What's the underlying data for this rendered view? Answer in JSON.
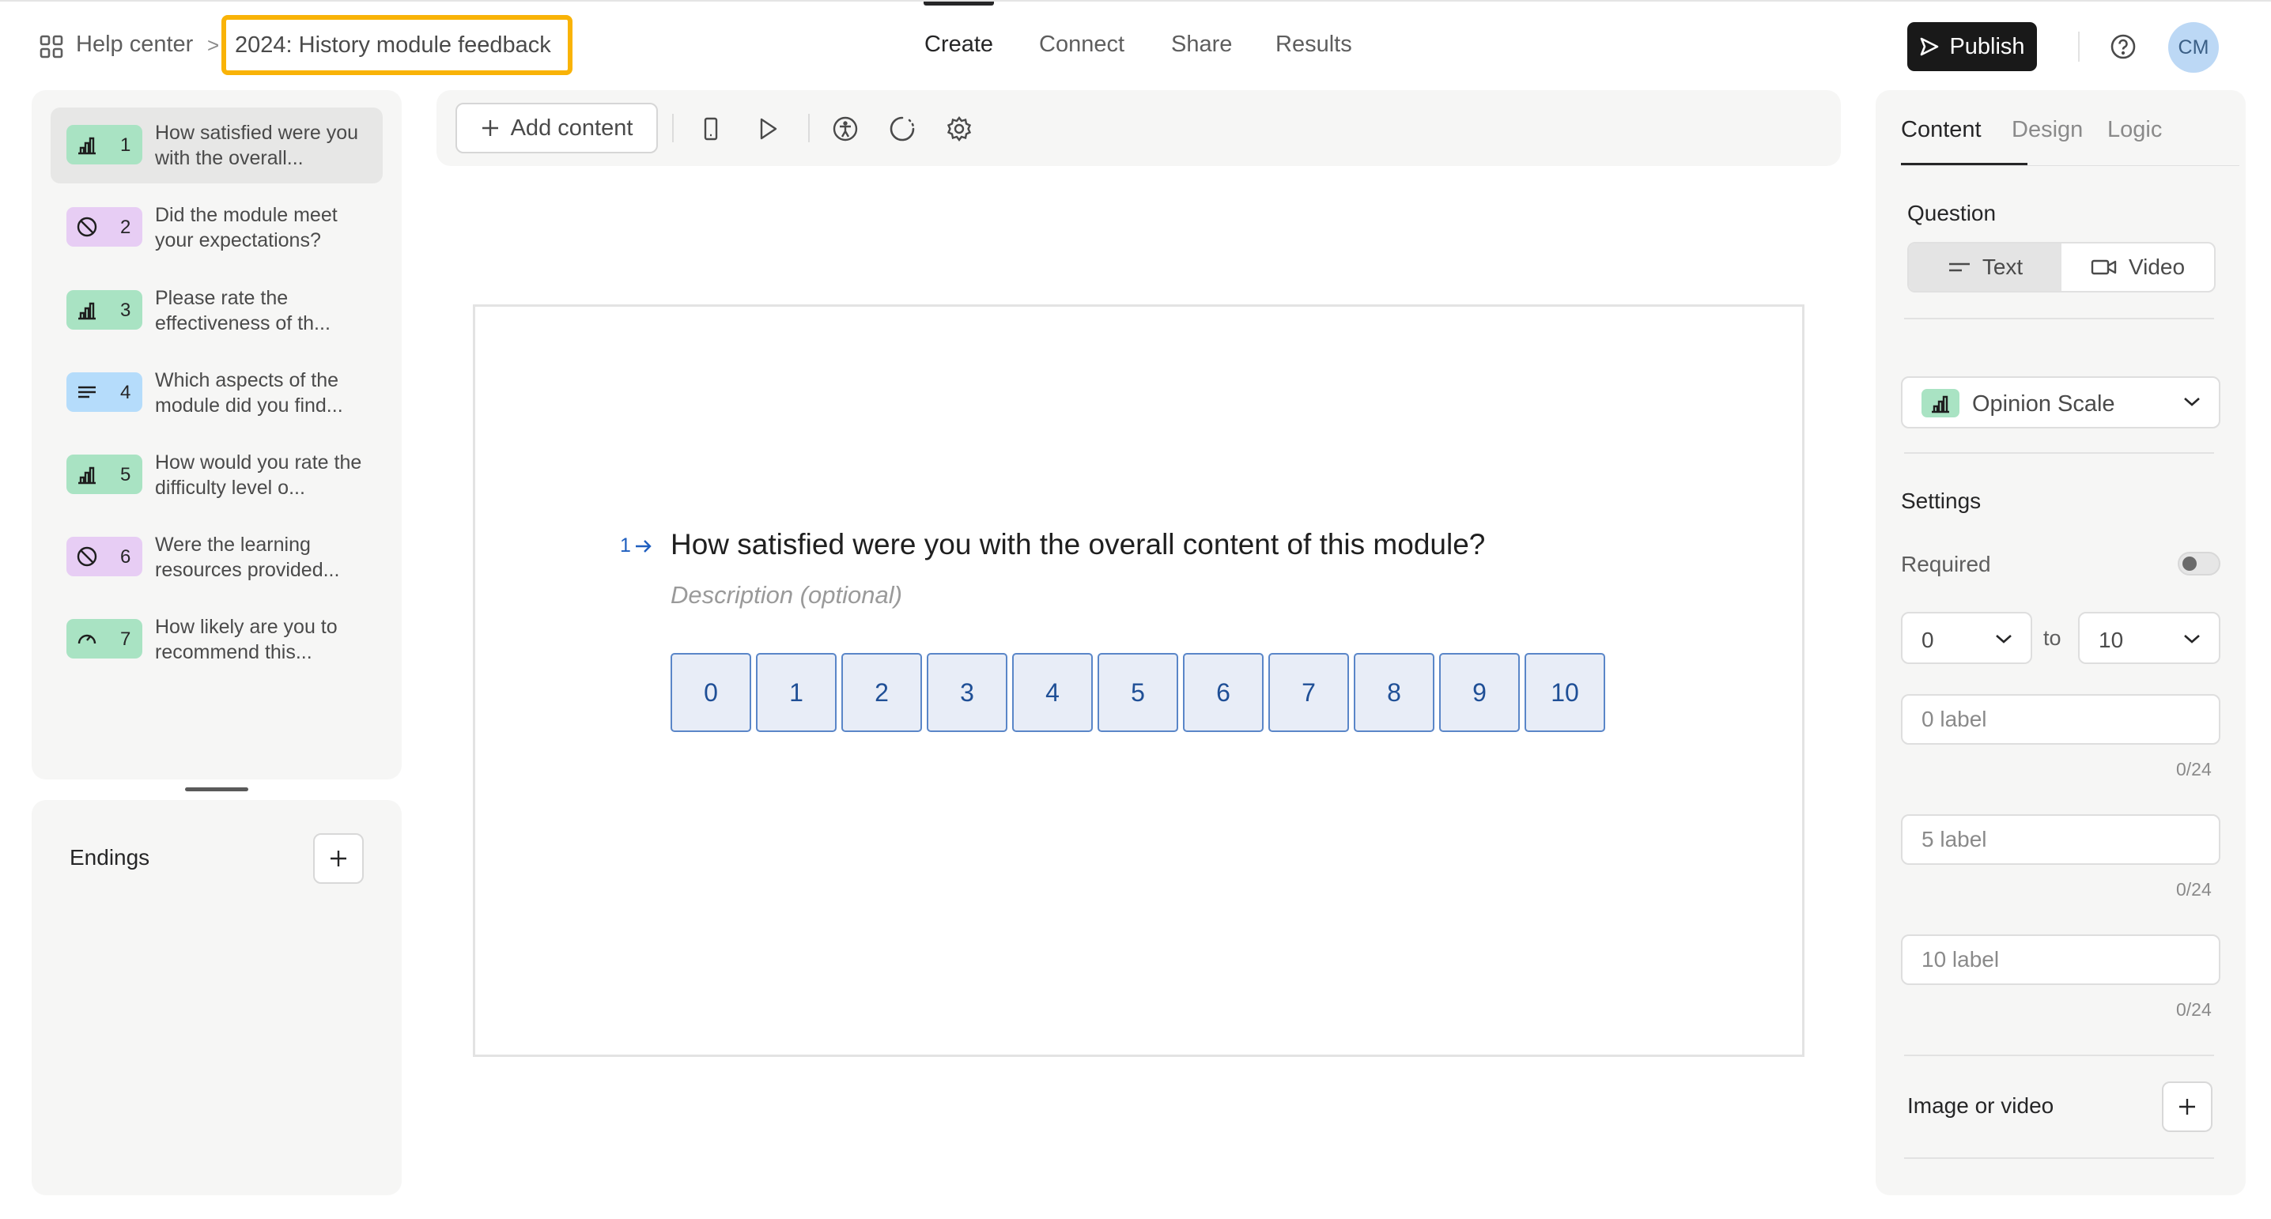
{
  "header": {
    "home_label": "Help center",
    "separator": ">",
    "form_title": "2024: History module feedback",
    "nav": [
      {
        "label": "Create",
        "active": true
      },
      {
        "label": "Connect",
        "active": false
      },
      {
        "label": "Share",
        "active": false
      },
      {
        "label": "Results",
        "active": false
      }
    ],
    "publish_label": "Publish",
    "avatar_initials": "CM"
  },
  "questions": [
    {
      "number": "1",
      "text": "How satisfied were you with the overall...",
      "type_icon": "opinion-scale-icon",
      "color": "#a9e3c3",
      "selected": true
    },
    {
      "number": "2",
      "text": "Did the module meet your expectations?",
      "type_icon": "yes-no-icon",
      "color": "#e7cdf4",
      "selected": false
    },
    {
      "number": "3",
      "text": "Please rate the effectiveness of th...",
      "type_icon": "opinion-scale-icon",
      "color": "#a9e3c3",
      "selected": false
    },
    {
      "number": "4",
      "text": "Which aspects of the module did you find...",
      "type_icon": "long-text-icon",
      "color": "#b5dcfb",
      "selected": false
    },
    {
      "number": "5",
      "text": "How would you rate the difficulty level o...",
      "type_icon": "opinion-scale-icon",
      "color": "#a9e3c3",
      "selected": false
    },
    {
      "number": "6",
      "text": "Were the learning resources provided...",
      "type_icon": "yes-no-icon",
      "color": "#e7cdf4",
      "selected": false
    },
    {
      "number": "7",
      "text": "How likely are you to recommend this...",
      "type_icon": "nps-gauge-icon",
      "color": "#a9e3c3",
      "selected": false
    }
  ],
  "endings": {
    "label": "Endings"
  },
  "toolbar": {
    "add_content_label": "Add content"
  },
  "editor": {
    "question_number": "1",
    "question_title": "How satisfied were you with the overall content of this module?",
    "description_placeholder": "Description (optional)",
    "scale": [
      "0",
      "1",
      "2",
      "3",
      "4",
      "5",
      "6",
      "7",
      "8",
      "9",
      "10"
    ]
  },
  "right_panel": {
    "tabs": [
      {
        "label": "Content",
        "active": true
      },
      {
        "label": "Design",
        "active": false
      },
      {
        "label": "Logic",
        "active": false
      }
    ],
    "question_label": "Question",
    "question_modes": [
      {
        "label": "Text",
        "active": true
      },
      {
        "label": "Video",
        "active": false
      }
    ],
    "question_type": "Opinion Scale",
    "settings_label": "Settings",
    "required_label": "Required",
    "required_on": false,
    "range_from": "0",
    "range_to_label": "to",
    "range_to": "10",
    "label_inputs": [
      {
        "placeholder": "0 label",
        "counter": "0/24"
      },
      {
        "placeholder": "5 label",
        "counter": "0/24"
      },
      {
        "placeholder": "10 label",
        "counter": "0/24"
      }
    ],
    "image_video_label": "Image or video"
  },
  "colors": {
    "accent_blue": "#1f5fbf",
    "publish_bg": "#191919",
    "highlight_outline": "#f9b307",
    "opinion_scale_green": "#a9e3c3"
  }
}
